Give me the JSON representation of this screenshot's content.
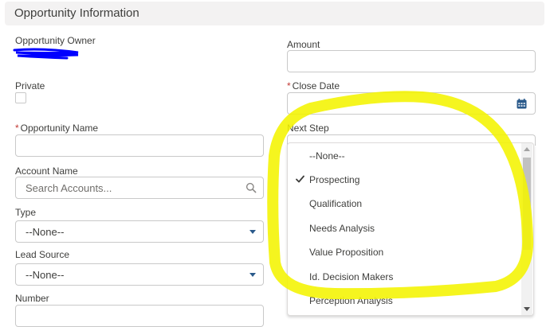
{
  "section": {
    "title": "Opportunity Information"
  },
  "left": {
    "owner_label": "Opportunity Owner",
    "private_label": "Private",
    "name_required_mark": "*",
    "name_label": "Opportunity Name",
    "name_value": "",
    "account_label": "Account Name",
    "account_placeholder": "Search Accounts...",
    "type_label": "Type",
    "type_value": "--None--",
    "lead_source_label": "Lead Source",
    "lead_source_value": "--None--",
    "number_label": "Number"
  },
  "right": {
    "amount_label": "Amount",
    "amount_value": "",
    "close_date_required_mark": "*",
    "close_date_label": "Close Date",
    "close_date_value": "",
    "next_step_label": "Next Step"
  },
  "dropdown": {
    "selected": "Prospecting",
    "options": [
      {
        "label": "--None--",
        "checked": false
      },
      {
        "label": "Prospecting",
        "checked": true
      },
      {
        "label": "Qualification",
        "checked": false
      },
      {
        "label": "Needs Analysis",
        "checked": false
      },
      {
        "label": "Value Proposition",
        "checked": false
      },
      {
        "label": "Id. Decision Makers",
        "checked": false
      },
      {
        "label": "Perception Analysis",
        "checked": false
      }
    ]
  },
  "icons": {
    "search": "search-icon",
    "calendar": "calendar-icon",
    "caret": "chevron-down-icon",
    "check": "checkmark-icon"
  },
  "colors": {
    "required": "#c23934",
    "highlight": "#f4f400",
    "redaction": "#0000ff",
    "caret": "#2a5a8b"
  }
}
